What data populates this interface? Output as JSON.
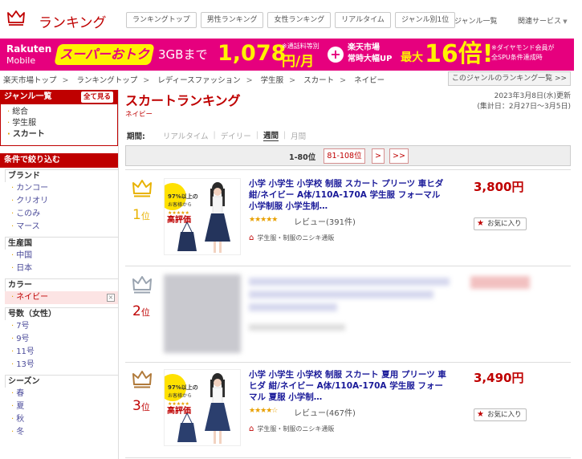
{
  "header": {
    "logo_text": "ランキング",
    "nav": [
      "ランキングトップ",
      "男性ランキング",
      "女性ランキング",
      "リアルタイム",
      "ジャンル別1位"
    ],
    "genre_link": "ジャンル一覧",
    "related_link": "関連サービス"
  },
  "banner": {
    "brand_line1": "Rakuten",
    "brand_line2": "Mobile",
    "super_deal": "スーパーおトク",
    "gb": "3GBまで",
    "price": "1,078",
    "note": "※通話料等別",
    "unit": "円/月",
    "plus": "+",
    "ichiba_line1": "楽天市場",
    "ichiba_line2": "常時大幅UP",
    "max": "最大",
    "times": "16倍!",
    "diamond_line1": "※ダイヤモンド会員が",
    "diamond_line2": "全SPU条件達成時"
  },
  "breadcrumb": [
    "楽天市場トップ",
    "ランキングトップ",
    "レディースファッション",
    "学生服",
    "スカート",
    "ネイビー"
  ],
  "breadcrumb_sep": ">",
  "genre_ranking_list": "このジャンルのランキング一覧 >>",
  "sidebar": {
    "genre_title": "ジャンル一覧",
    "see_all": "全て見る",
    "genres": [
      "総合",
      "学生服",
      "スカート"
    ],
    "filter_title": "条件で絞り込む",
    "brand": {
      "title": "ブランド",
      "items": [
        "カンコー",
        "クリオリ",
        "このみ",
        "マース"
      ]
    },
    "origin": {
      "title": "生産国",
      "items": [
        "中国",
        "日本"
      ]
    },
    "color": {
      "title": "カラー",
      "selected": "ネイビー",
      "clear": "×"
    },
    "size": {
      "title": "号数（女性）",
      "items": [
        "7号",
        "9号",
        "11号",
        "13号"
      ]
    },
    "season": {
      "title": "シーズン",
      "items": [
        "春",
        "夏",
        "秋",
        "冬"
      ]
    }
  },
  "main": {
    "title": "スカートランキング",
    "subtitle": "ネイビー",
    "updated": "2023年3月8日(水)更新",
    "period_range": "(集計日：2月27日～3月5日)",
    "period_label": "期間:",
    "periods": [
      "リアルタイム",
      "デイリー",
      "週間",
      "月間"
    ],
    "period_active": "週間",
    "pager_current": "1-80位",
    "pager_next_range": "81-108位",
    "pager_next": ">",
    "pager_last": ">>"
  },
  "items": [
    {
      "rank": "1",
      "rank_suffix": "位",
      "crown_color": "#e8b200",
      "title": "小学 小学生 小学校 制服 スカート プリーツ 車ヒダ 紺/ネイビー A体/110A-170A 学生服 フォーマル 小学制服 小学生制…",
      "stars": "★★★★★",
      "reviews": "レビュー(391件)",
      "shop": "学生服・制服のニシキ通販",
      "price": "3,800円",
      "fav": "お気に入り"
    },
    {
      "rank": "2",
      "rank_suffix": "位",
      "crown_color": "#9aa4b0"
    },
    {
      "rank": "3",
      "rank_suffix": "位",
      "crown_color": "#b07a3a",
      "title": "小学 小学生 小学校 制服 スカート 夏用 プリーツ 車ヒダ 紺/ネイビー A体/110A-170A 学生服 フォーマル 夏服 小学制…",
      "stars": "★★★★☆",
      "reviews": "レビュー(467件)",
      "shop": "学生服・制服のニシキ通販",
      "price": "3,490円",
      "fav": "お気に入り"
    }
  ],
  "thumb_badge": {
    "top": "97%以上の",
    "mid": "お客様から",
    "stars": "★★★★★",
    "main": "高評価"
  },
  "colors": {
    "accent": "#bf0000",
    "banner": "#e6007e",
    "banner_yellow": "#fff200",
    "link": "#1a1a99"
  }
}
